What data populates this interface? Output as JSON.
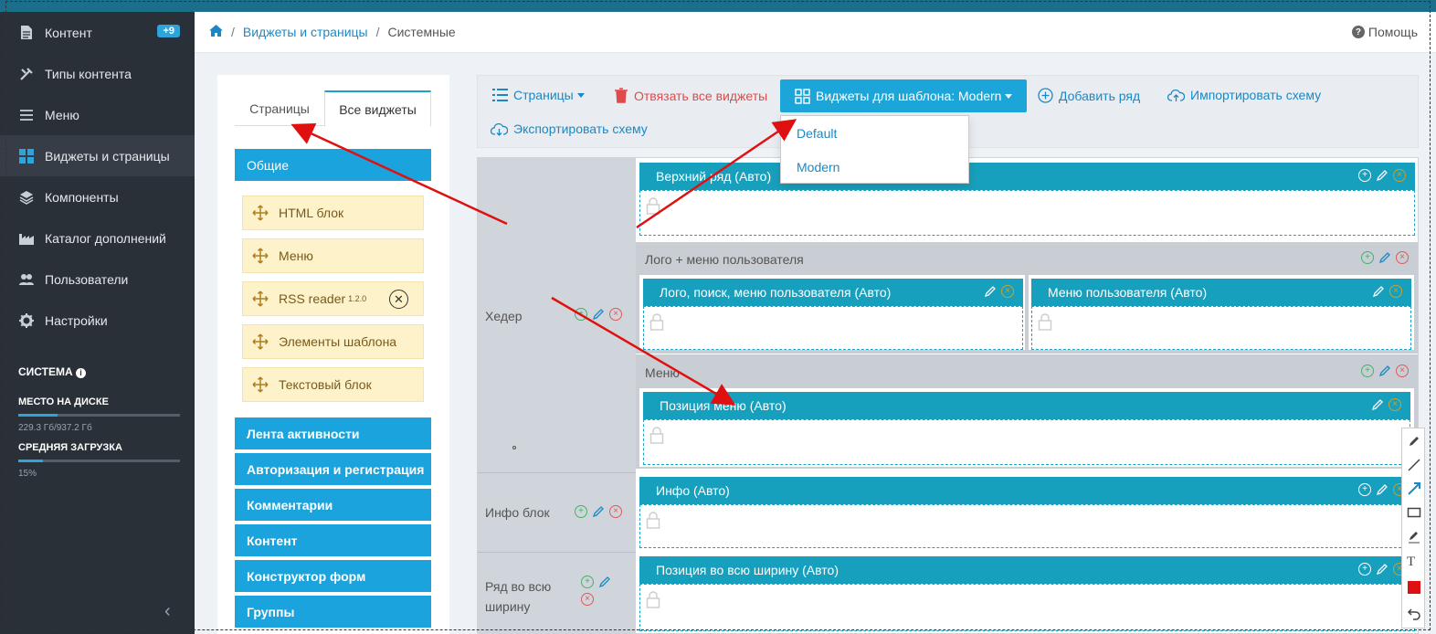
{
  "sidebar": {
    "items": [
      {
        "label": "Контент",
        "icon": "document-icon",
        "badge": "+9"
      },
      {
        "label": "Типы контента",
        "icon": "tools-icon"
      },
      {
        "label": "Меню",
        "icon": "hamburger-icon"
      },
      {
        "label": "Виджеты и страницы",
        "icon": "grid-icon",
        "active": true
      },
      {
        "label": "Компоненты",
        "icon": "layers-icon"
      },
      {
        "label": "Каталог дополнений",
        "icon": "factory-icon"
      },
      {
        "label": "Пользователи",
        "icon": "users-icon"
      },
      {
        "label": "Настройки",
        "icon": "gear-icon"
      }
    ],
    "system": {
      "title": "СИСТЕМА",
      "disk_label": "МЕСТО НА ДИСКЕ",
      "disk_value": "229.3 Гб/937.2 Гб",
      "disk_fraction": 0.245,
      "load_label": "СРЕДНЯЯ ЗАГРУЗКА",
      "load_value": "15%",
      "load_fraction": 0.15
    }
  },
  "header": {
    "breadcrumbs": [
      "Виджеты и страницы",
      "Системные"
    ],
    "help_label": "Помощь"
  },
  "widgets_panel": {
    "tabs": [
      "Страницы",
      "Все виджеты"
    ],
    "categories_top": "Общие",
    "widgets": [
      {
        "label": "HTML блок"
      },
      {
        "label": "Меню"
      },
      {
        "label": "RSS reader",
        "version": "1.2.0"
      },
      {
        "label": "Элементы шаблона"
      },
      {
        "label": "Текстовый блок"
      }
    ],
    "categories": [
      "Лента активности",
      "Авторизация и регистрация",
      "Комментарии",
      "Контент",
      "Конструктор форм",
      "Группы"
    ]
  },
  "toolbar": {
    "pages_label": "Страницы",
    "unbind_label": "Отвязать все виджеты",
    "template_label": "Виджеты для шаблона: Modern",
    "add_row_label": "Добавить ряд",
    "import_label": "Импортировать схему",
    "export_label": "Экспортировать схему",
    "template_options": [
      "Default",
      "Modern"
    ]
  },
  "scheme": {
    "rows": [
      {
        "label": "Хедер"
      },
      {
        "label": "Инфо блок"
      },
      {
        "label": "Ряд во всю ширину"
      }
    ],
    "top_row": "Верхний ряд (Авто)",
    "group_logo": "Лого + меню пользователя",
    "logo_col": "Лого, поиск, меню пользователя (Авто)",
    "usermenu_col": "Меню пользователя (Авто)",
    "group_menu": "Меню",
    "menu_pos": "Позиция меню (Авто)",
    "info_pos": "Инфо (Авто)",
    "fullwidth_pos": "Позиция во всю ширину (Авто)"
  },
  "colors": {
    "accent": "#1aa3dc",
    "section_header": "#17a0bd",
    "annotation": "#e01010"
  }
}
